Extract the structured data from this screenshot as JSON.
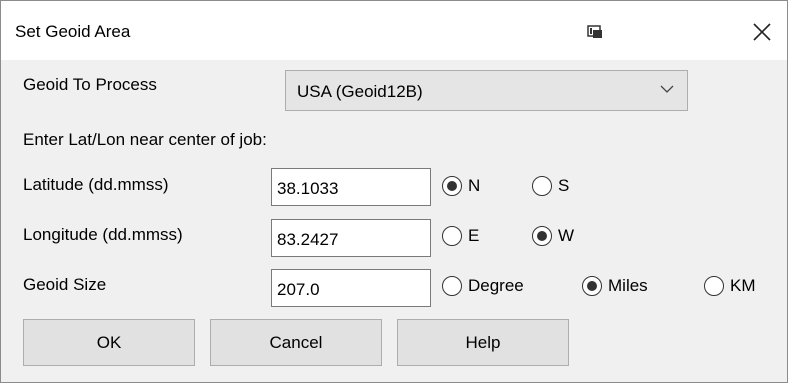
{
  "window": {
    "title": "Set Geoid Area",
    "icons": [
      "pin-icon",
      "close-icon"
    ]
  },
  "geoid": {
    "label": "Geoid To Process",
    "selected": "USA (Geoid12B)"
  },
  "instruction": "Enter Lat/Lon near center of job:",
  "latitude": {
    "label": "Latitude (dd.mmss)",
    "value": "38.1033",
    "options": [
      "N",
      "S"
    ],
    "selected": "N"
  },
  "longitude": {
    "label": "Longitude (dd.mmss)",
    "value": "83.2427",
    "options": [
      "E",
      "W"
    ],
    "selected": "W"
  },
  "size": {
    "label": "Geoid Size",
    "value": "207.0",
    "options": [
      "Degree",
      "Miles",
      "KM"
    ],
    "selected": "Miles"
  },
  "buttons": {
    "ok": "OK",
    "cancel": "Cancel",
    "help": "Help"
  }
}
